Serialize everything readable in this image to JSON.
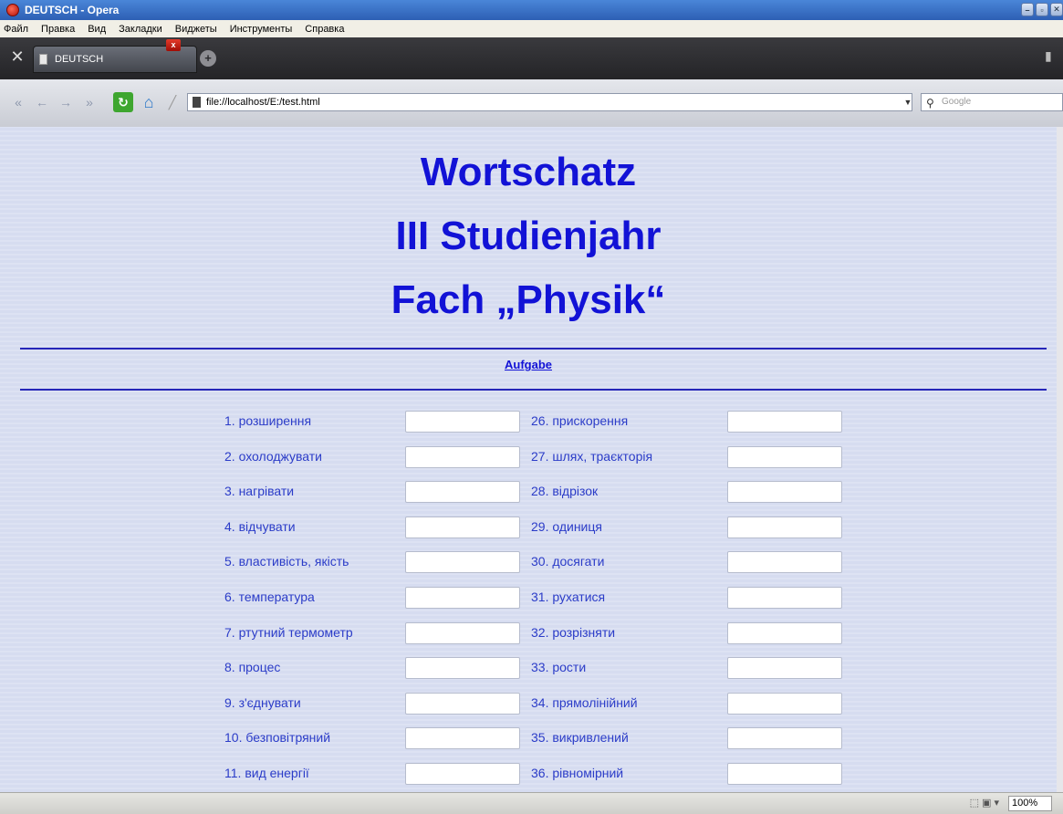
{
  "window": {
    "title": "DEUTSCH - Opera"
  },
  "menu": [
    "Файл",
    "Правка",
    "Вид",
    "Закладки",
    "Виджеты",
    "Инструменты",
    "Справка"
  ],
  "tab": {
    "title": "DEUTSCH"
  },
  "address": {
    "url": "file://localhost/E:/test.html",
    "search_placeholder": "Google"
  },
  "page": {
    "heading": [
      "Wortschatz",
      "III Studienjahr",
      "Fach „Physik“"
    ],
    "task_link": "Aufgabe",
    "left_words": [
      "1. розширення",
      "2. охолоджувати",
      "3. нагрівати",
      "4. відчувати",
      "5. властивість, якість",
      "6. температура",
      "7. ртутний термометр",
      "8. процес",
      "9. з'єднувати",
      "10. безповітряний",
      "11. вид енергії"
    ],
    "right_words": [
      "26. прискорення",
      "27. шлях, траєкторія",
      "28. відрізок",
      "29. одиниця",
      "30. досягати",
      "31. рухатися",
      "32. розрізняти",
      "33. рости",
      "34. прямолінійний",
      "35. викривлений",
      "36. рівномірний"
    ]
  },
  "status": {
    "zoom": "100%"
  },
  "colors": {
    "heading": "#1212d6",
    "word": "#2b3cc8",
    "background": "#d6dcf0"
  }
}
